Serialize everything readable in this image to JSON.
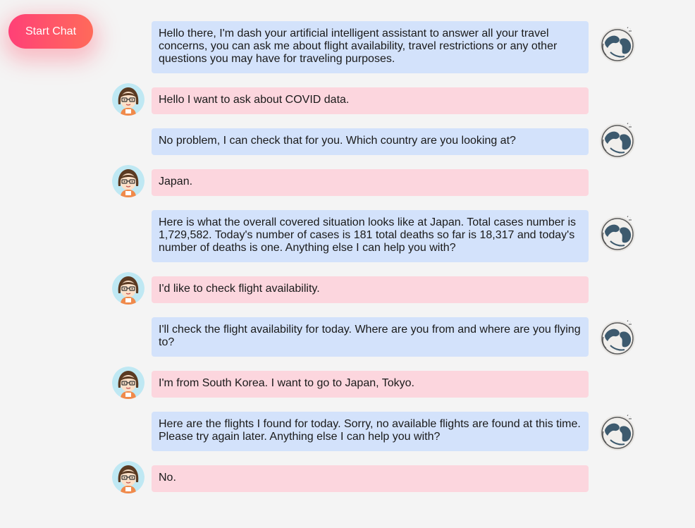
{
  "start_button": {
    "label": "Start Chat"
  },
  "messages": [
    {
      "role": "bot",
      "text": "Hello there, I'm dash your artificial intelligent assistant to answer all your travel concerns, you can ask me about flight availability, travel restrictions or any other questions you may have for traveling purposes."
    },
    {
      "role": "user",
      "text": "Hello I want to ask about COVID data."
    },
    {
      "role": "bot",
      "text": "No problem, I can check that for you. Which country are you looking at?"
    },
    {
      "role": "user",
      "text": "Japan."
    },
    {
      "role": "bot",
      "text": "Here is what the overall covered situation looks like at Japan. Total cases number is 1,729,582. Today's number of cases is 181 total deaths so far is 18,317 and today's number of deaths is one. Anything else I can help you with?"
    },
    {
      "role": "user",
      "text": "I'd like to check flight availability."
    },
    {
      "role": "bot",
      "text": "I'll check the flight availability for today. Where are you from and where are you flying to?"
    },
    {
      "role": "user",
      "text": "I'm from South Korea. I want to go to Japan, Tokyo."
    },
    {
      "role": "bot",
      "text": "Here are the flights I found for today. Sorry, no available flights are found at this time. Please try again later. Anything else I can help you with?"
    },
    {
      "role": "user",
      "text": "No."
    }
  ],
  "icons": {
    "bot_avatar": "globe-bot-avatar-icon",
    "user_avatar": "girl-glasses-avatar-icon"
  },
  "colors": {
    "bot_bubble": "#d3e2fb",
    "user_bubble": "#fcd6de",
    "button_gradient_start": "#ff4077",
    "button_gradient_end": "#ff6a5a",
    "background": "#f4f4f4"
  }
}
